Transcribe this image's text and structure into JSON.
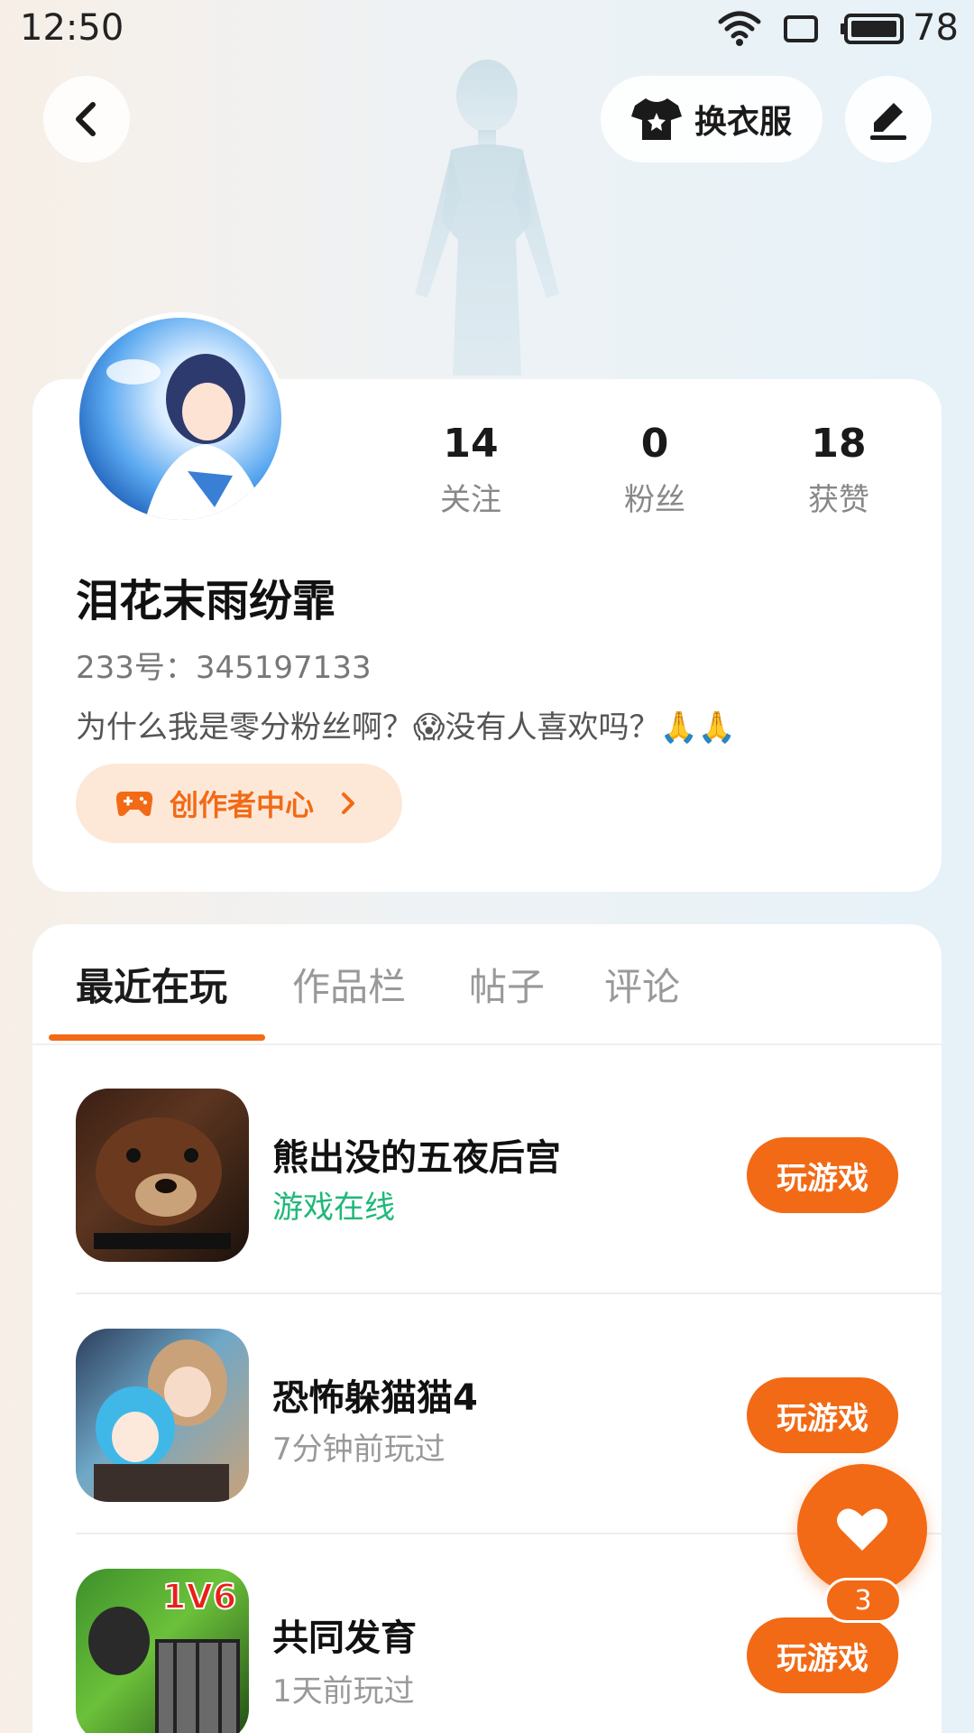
{
  "status_bar": {
    "time": "12:50",
    "battery": "78"
  },
  "header": {
    "outfit_label": "换衣服"
  },
  "profile": {
    "stats": [
      {
        "value": "14",
        "label": "关注"
      },
      {
        "value": "0",
        "label": "粉丝"
      },
      {
        "value": "18",
        "label": "获赞"
      }
    ],
    "username": "泪花末雨纷霏",
    "user_id": "233号：345197133",
    "bio": "为什么我是零分粉丝啊？😱没有人喜欢吗？🙏🙏",
    "creator_center_label": "创作者中心"
  },
  "tabs": [
    {
      "label": "最近在玩",
      "active": true
    },
    {
      "label": "作品栏",
      "active": false
    },
    {
      "label": "帖子",
      "active": false
    },
    {
      "label": "评论",
      "active": false
    }
  ],
  "games": [
    {
      "name": "熊出没的五夜后宫",
      "status": "游戏在线",
      "button": "玩游戏"
    },
    {
      "name": "恐怖躲猫猫4",
      "status": "7分钟前玩过",
      "button": "玩游戏"
    },
    {
      "name": "共同发育",
      "status": "1天前玩过",
      "button": "玩游戏"
    }
  ],
  "icon_text": {
    "game3_badge": "1V6"
  },
  "like_fab": {
    "count": "3"
  },
  "colors": {
    "accent": "#f26a16",
    "online": "#20b87a",
    "creator_bg": "#fde8d8"
  }
}
